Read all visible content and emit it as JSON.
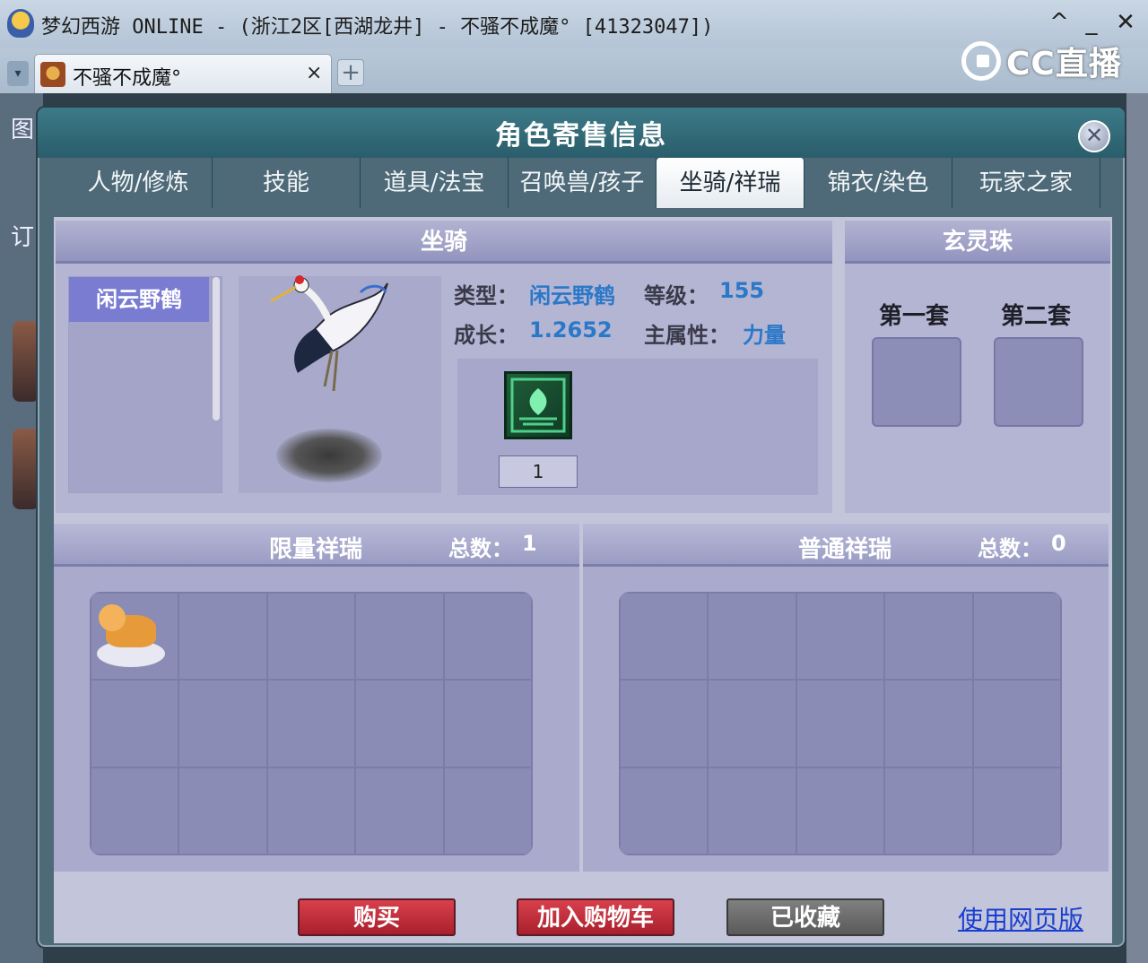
{
  "window": {
    "title": "梦幻西游 ONLINE - (浙江2区[西湖龙井] - 不骚不成魔° [41323047])",
    "btn_up": "^",
    "btn_min": "_",
    "btn_close": "✕"
  },
  "browser_tab": {
    "label": "不骚不成魔°",
    "close": "×",
    "add": "+",
    "menu": "▾"
  },
  "watermark": {
    "text": "CC直播"
  },
  "background": {
    "text1": "图",
    "text2": "订"
  },
  "dialog": {
    "title": "角色寄售信息",
    "close": "✕",
    "tabs": [
      {
        "label": "人物/修炼"
      },
      {
        "label": "技能"
      },
      {
        "label": "道具/法宝"
      },
      {
        "label": "召唤兽/孩子"
      },
      {
        "label": "坐骑/祥瑞",
        "active": true
      },
      {
        "label": "锦衣/染色"
      },
      {
        "label": "玩家之家"
      }
    ]
  },
  "mount": {
    "header": "坐骑",
    "list": [
      "闲云野鹤"
    ],
    "type_label": "类型：",
    "type_value": "闲云野鹤",
    "level_label": "等级：",
    "level_value": "155",
    "growth_label": "成长：",
    "growth_value": "1.2652",
    "attr_label": "主属性：",
    "attr_value": "力量",
    "skill_level": "1"
  },
  "orb": {
    "header": "玄灵珠",
    "set1": "第一套",
    "set2": "第二套"
  },
  "lucky": {
    "limited": {
      "title": "限量祥瑞",
      "count_label": "总数：",
      "count": "1"
    },
    "normal": {
      "title": "普通祥瑞",
      "count_label": "总数：",
      "count": "0"
    }
  },
  "footer": {
    "buy": "购买",
    "add_cart": "加入购物车",
    "favorited": "已收藏",
    "web_version": "使用网页版"
  },
  "colors": {
    "accent_blue": "#2a78c8",
    "button_red": "#c0303c",
    "link_blue": "#1a3fd0"
  }
}
